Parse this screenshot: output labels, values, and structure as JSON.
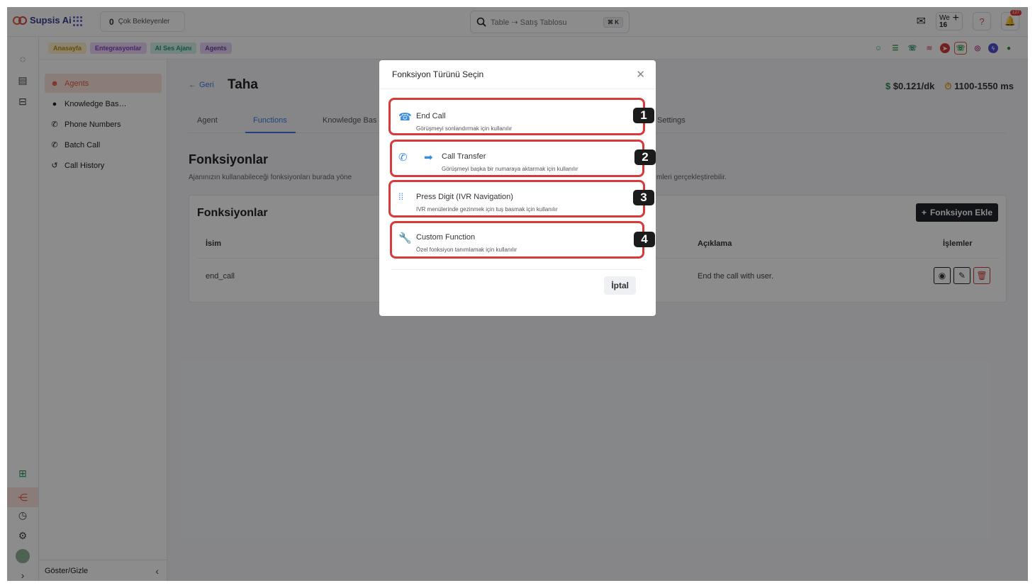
{
  "topbar": {
    "brand": "Supsis Ai",
    "waiting_count": "0",
    "waiting_label": "Çok Bekleyenler",
    "search_placeholder": "Table ⇢ Satış Tablosu",
    "search_shortcut": "⌘ K",
    "we_label": "We",
    "we_number": "16",
    "notif_count": "127"
  },
  "crumbs": [
    {
      "label": "Anasayfa",
      "bg": "#fdf0c8",
      "fg": "#c08a10"
    },
    {
      "label": "Entegrasyonlar",
      "bg": "#ead8f6",
      "fg": "#8a3fc0"
    },
    {
      "label": "AI Ses Ajanı",
      "bg": "#d4f1ea",
      "fg": "#2a9a7a"
    },
    {
      "label": "Agents",
      "bg": "#e6d8f6",
      "fg": "#6b3fb0"
    }
  ],
  "sidebar": {
    "items": [
      {
        "label": "Agents",
        "icon": "robot-icon"
      },
      {
        "label": "Knowledge Bas…",
        "icon": "lightbulb-icon"
      },
      {
        "label": "Phone Numbers",
        "icon": "phone-icon"
      },
      {
        "label": "Batch Call",
        "icon": "phone-icon"
      },
      {
        "label": "Call History",
        "icon": "history-icon"
      }
    ],
    "footer": "Göster/Gizle"
  },
  "main": {
    "back": "Geri",
    "agent_name": "Taha",
    "cost": "$0.121/dk",
    "latency": "1100-1550 ms",
    "tabs": [
      "Agent",
      "Functions",
      "Knowledge Bas",
      "Settings"
    ],
    "section_title": "Fonksiyonlar",
    "section_desc": "Ajanınızın kullanabileceği fonksiyonları burada yöne",
    "section_desc_tail": "mleri gerçekleştirebilir.",
    "card_title": "Fonksiyonlar",
    "add_button": "Fonksiyon Ekle",
    "table": {
      "headers": [
        "İsim",
        "Açıklama",
        "İşlemler"
      ],
      "rows": [
        {
          "name": "end_call",
          "description": "End the call with user."
        }
      ]
    }
  },
  "modal": {
    "title": "Fonksiyon Türünü Seçin",
    "options": [
      {
        "name": "End Call",
        "desc": "Görüşmeyi sonlandırmak için kullanılır",
        "icon": "hangup-icon",
        "number": "1"
      },
      {
        "name": "Call Transfer",
        "desc": "Görüşmeyi başka bir numaraya aktarmak için kullanılır",
        "icon": "call-transfer-icon",
        "number": "2"
      },
      {
        "name": "Press Digit (IVR Navigation)",
        "desc": "IVR menülerinde gezinmek için tuş basmak için kullanılır",
        "icon": "dialpad-icon",
        "number": "3"
      },
      {
        "name": "Custom Function",
        "desc": "Özel fonksiyon tanımlamak için kullanılır",
        "icon": "wrench-icon",
        "number": "4"
      }
    ],
    "cancel": "İptal"
  },
  "colors": {
    "accent": "#3b7be0",
    "brand": "#e0603c",
    "highlight": "#d63a3a"
  }
}
